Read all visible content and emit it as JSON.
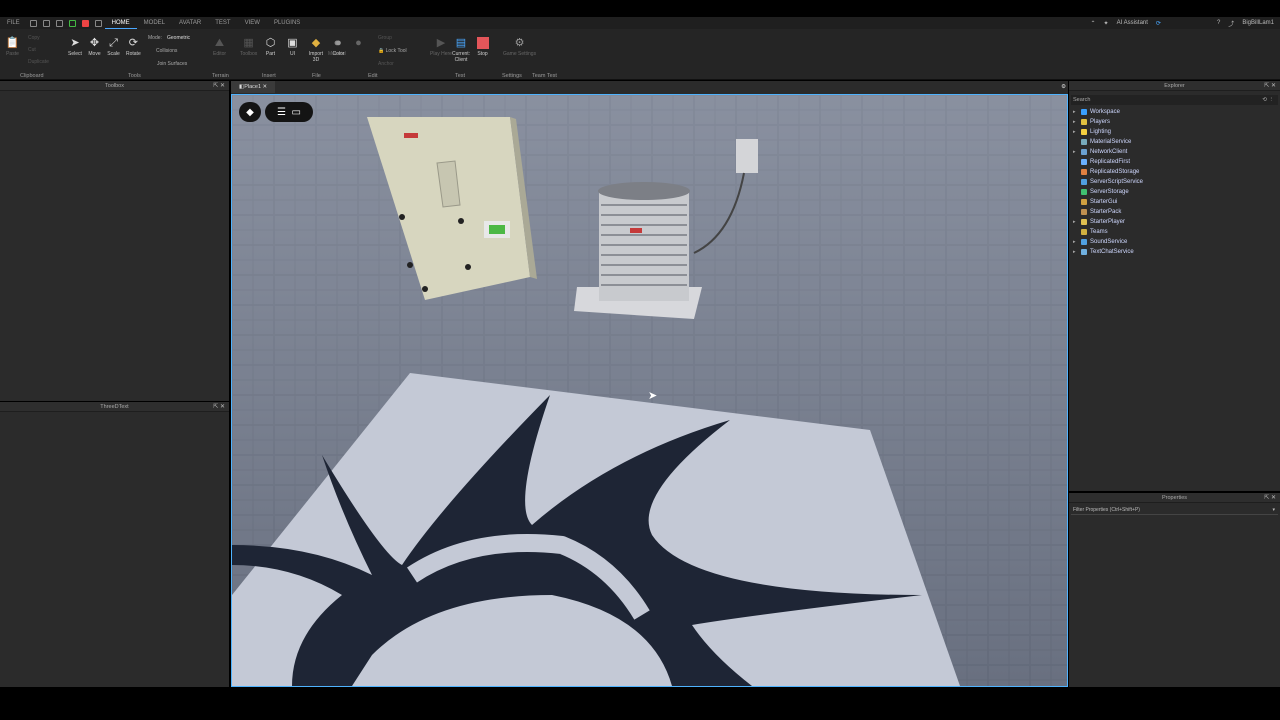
{
  "menubar": {
    "file": "FILE",
    "tabs": [
      "HOME",
      "MODEL",
      "AVATAR",
      "TEST",
      "VIEW",
      "PLUGINS"
    ],
    "active_tab": "HOME",
    "ai_assistant": "AI Assistant",
    "username": "BigBillLam1"
  },
  "ribbon": {
    "clipboard": {
      "paste": "Paste",
      "copy": "Copy",
      "cut": "Cut",
      "duplicate": "Duplicate",
      "group_label": "Clipboard"
    },
    "tools": {
      "select": "Select",
      "move": "Move",
      "scale": "Scale",
      "rotate": "Rotate",
      "group_label": "Tools"
    },
    "mode": {
      "label": "Mode:",
      "value": "Geometric",
      "collisions": "Collisions",
      "join_surfaces": "Join Surfaces"
    },
    "terrain": {
      "editor": "Editor",
      "group_label": "Terrain"
    },
    "insert": {
      "toolbox": "Toolbox",
      "part": "Part",
      "ui": "UI",
      "group_label": "Insert"
    },
    "file": {
      "import3d": "Import 3D",
      "group_label": "File"
    },
    "edit": {
      "material": "Material",
      "color": "Color",
      "group": "Group",
      "lock_tool": "Lock Tool",
      "anchor": "Anchor",
      "group_label": "Edit"
    },
    "test": {
      "play_here": "Play Here",
      "current_client": "Current: Client",
      "stop": "Stop",
      "group_label": "Test"
    },
    "settings": {
      "game_settings": "Game Settings",
      "group_label": "Settings"
    },
    "team_test": {
      "group_label": "Team Test"
    }
  },
  "panels": {
    "toolbox": "Toolbox",
    "three_d_text": "ThreeDText",
    "explorer": "Explorer",
    "properties": "Properties",
    "search_placeholder": "Search",
    "filter_placeholder": "Filter Properties (Ctrl+Shift+P)"
  },
  "viewport": {
    "tab": "Place1"
  },
  "explorer_items": [
    {
      "label": "Workspace",
      "color": "#3aa0ff",
      "arrow": true
    },
    {
      "label": "Players",
      "color": "#e0c040",
      "arrow": true
    },
    {
      "label": "Lighting",
      "color": "#f5d040",
      "arrow": true
    },
    {
      "label": "MaterialService",
      "color": "#7ab",
      "arrow": false
    },
    {
      "label": "NetworkClient",
      "color": "#6aa0d0",
      "arrow": true
    },
    {
      "label": "ReplicatedFirst",
      "color": "#6ab0ff",
      "arrow": false
    },
    {
      "label": "ReplicatedStorage",
      "color": "#e08040",
      "arrow": false
    },
    {
      "label": "ServerScriptService",
      "color": "#50a0e0",
      "arrow": false
    },
    {
      "label": "ServerStorage",
      "color": "#40c070",
      "arrow": false
    },
    {
      "label": "StarterGui",
      "color": "#d0a040",
      "arrow": false
    },
    {
      "label": "StarterPack",
      "color": "#c09050",
      "arrow": false
    },
    {
      "label": "StarterPlayer",
      "color": "#e0c050",
      "arrow": true
    },
    {
      "label": "Teams",
      "color": "#d0b040",
      "arrow": false
    },
    {
      "label": "SoundService",
      "color": "#50a0e0",
      "arrow": true
    },
    {
      "label": "TextChatService",
      "color": "#70b0e0",
      "arrow": true
    }
  ],
  "colors": {
    "accent": "#4fb3ff",
    "panel": "#2b2b2b",
    "stop_red": "#e4565a"
  }
}
